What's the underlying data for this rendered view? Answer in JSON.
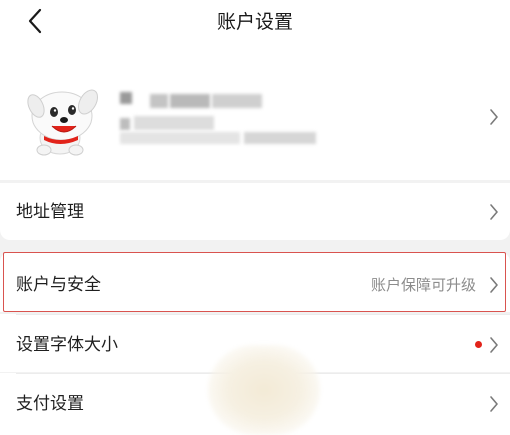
{
  "header": {
    "title": "账户设置",
    "back_icon": "chevron-left-icon"
  },
  "profile": {
    "avatar_icon": "jd-dog-mascot-avatar",
    "name_redacted": true,
    "info_redacted": true,
    "chevron_icon": "chevron-right-icon"
  },
  "menu": {
    "address": {
      "label": "地址管理"
    },
    "account_security": {
      "label": "账户与安全",
      "subtitle": "账户保障可升级"
    },
    "font_size": {
      "label": "设置字体大小",
      "badge_color": "#e2231a"
    },
    "payment": {
      "label": "支付设置"
    }
  },
  "colors": {
    "background": "#f2f2f2",
    "card": "#ffffff",
    "highlight_border": "#d9534f",
    "subtitle_text": "#8c8c8c",
    "red_dot": "#e2231a"
  }
}
